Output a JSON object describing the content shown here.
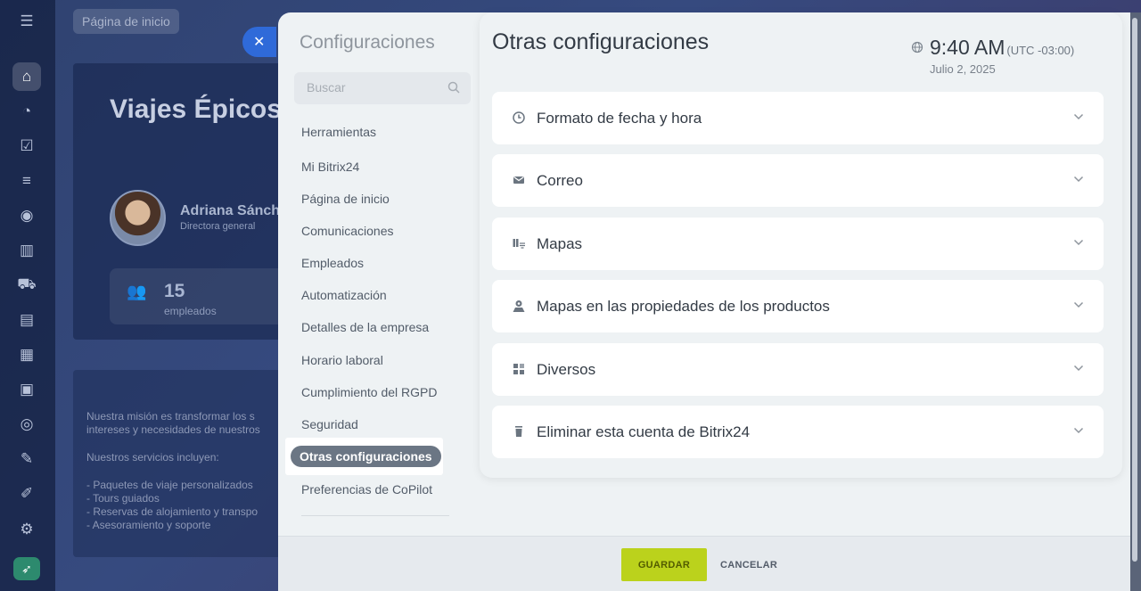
{
  "background": {
    "breadcrumb": "Página de inicio",
    "company_title": "Viajes Épicos",
    "person_name": "Adriana Sánch",
    "person_role": "Directora general",
    "employee_count": "15",
    "employee_label": "empleados",
    "mission_lines": [
      "Nuestra misión es transformar los s",
      "intereses y necesidades de nuestros"
    ],
    "services_intro": "Nuestros servicios incluyen:",
    "services": [
      "- Paquetes de viaje personalizados",
      "- Tours guiados",
      "- Reservas de alojamiento y transpo",
      "- Asesoramiento y soporte"
    ]
  },
  "settings": {
    "title": "Configuraciones",
    "search_placeholder": "Buscar",
    "nav": [
      "Herramientas",
      "Mi Bitrix24",
      "Página de inicio",
      "Comunicaciones",
      "Empleados",
      "Automatización",
      "Detalles de la empresa",
      "Horario laboral",
      "Cumplimiento del RGPD",
      "Seguridad",
      "Otras configuraciones",
      "Preferencias de CoPilot"
    ],
    "active_nav": "Otras configuraciones"
  },
  "content": {
    "title": "Otras configuraciones",
    "time": "9:40 AM",
    "timezone": "(UTC -03:00)",
    "date": "Julio 2, 2025",
    "sections": [
      {
        "label": "Formato de fecha y hora",
        "icon": "clock-icon"
      },
      {
        "label": "Correo",
        "icon": "envelope-icon"
      },
      {
        "label": "Mapas",
        "icon": "map-icon"
      },
      {
        "label": "Mapas en las propiedades de los productos",
        "icon": "map-pin-icon"
      },
      {
        "label": "Diversos",
        "icon": "grid-icon"
      },
      {
        "label": "Eliminar esta cuenta de Bitrix24",
        "icon": "trash-icon"
      }
    ]
  },
  "footer": {
    "save_label": "GUARDAR",
    "cancel_label": "CANCELAR"
  },
  "colors": {
    "accent_green": "#bbd21c",
    "active_nav_bg": "#6b7684",
    "close_button": "#2f6ad9"
  }
}
